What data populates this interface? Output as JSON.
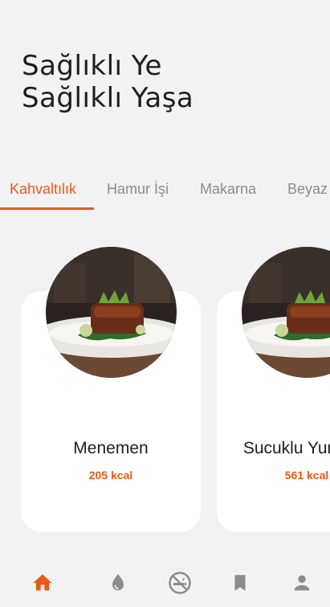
{
  "header": {
    "title_line1": "Sağlıklı Ye",
    "title_line2": "Sağlıklı Yaşa"
  },
  "tabs": [
    {
      "label": "Kahvaltılık",
      "active": true
    },
    {
      "label": "Hamur İşi",
      "active": false
    },
    {
      "label": "Makarna",
      "active": false
    },
    {
      "label": "Beyaz",
      "active": false
    }
  ],
  "recipes": [
    {
      "name": "Menemen",
      "kcal": "205 kcal"
    },
    {
      "name": "Sucuklu Yumurta",
      "kcal": "561 kcal"
    }
  ],
  "bottom_nav": [
    {
      "icon": "home-icon",
      "active": true
    },
    {
      "icon": "water-drop-icon",
      "active": false
    },
    {
      "icon": "no-smoking-icon",
      "active": false
    },
    {
      "icon": "bookmark-icon",
      "active": false
    },
    {
      "icon": "person-icon",
      "active": false
    }
  ],
  "colors": {
    "accent": "#e85a18",
    "inactive_icon": "#8c8c8c",
    "background": "#f2f2f2",
    "card": "#ffffff"
  }
}
